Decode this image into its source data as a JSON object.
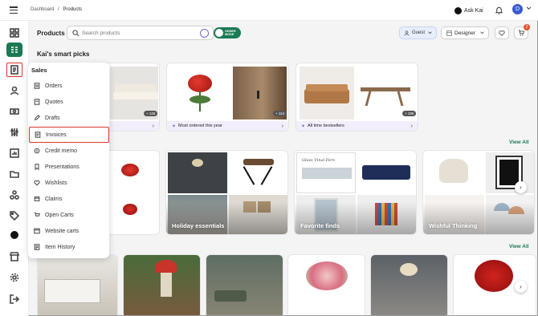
{
  "topbar": {
    "breadcrumb_root": "Dashboard",
    "breadcrumb_sep": "/",
    "breadcrumb_current": "Products",
    "ask_label": "Ask Kai",
    "avatar_initial": "D"
  },
  "header": {
    "title": "Products",
    "search_placeholder": "Search products",
    "order_mode_label": "ORDER MODE",
    "guest_label": "Guest",
    "designer_label": "Designer",
    "cart_count": "2"
  },
  "smart_picks": {
    "title": "Kai's smart picks",
    "cards": [
      {
        "badge": "+ 126",
        "caption": ""
      },
      {
        "badge": "+ 114",
        "caption": "Most ordered this year"
      },
      {
        "badge": "+ 195",
        "caption": "All time bestsellers"
      }
    ]
  },
  "collections": {
    "view_all": "View All",
    "cards": [
      {
        "label": ""
      },
      {
        "label": "Holiday essentials"
      },
      {
        "label": "Favorite finds",
        "art_text": "Glass Vinal Fers"
      },
      {
        "label": "Wishful Thinking"
      }
    ]
  },
  "products": {
    "view_all": "View All"
  },
  "sales_menu": {
    "title": "Sales",
    "items": [
      {
        "label": "Orders"
      },
      {
        "label": "Quotes"
      },
      {
        "label": "Drafts"
      },
      {
        "label": "Invoices"
      },
      {
        "label": "Credit memo"
      },
      {
        "label": "Presentations"
      },
      {
        "label": "Wishlists"
      },
      {
        "label": "Claims"
      },
      {
        "label": "Open Carts"
      },
      {
        "label": "Website carts"
      },
      {
        "label": "Item History"
      }
    ]
  },
  "colors": {
    "brand_green": "#1a7a53",
    "highlight_red": "#d9362b",
    "accent_purple": "#e9e3f8",
    "cart_badge": "#e8542f"
  },
  "icons": [
    "menu-icon",
    "bell-icon",
    "chevron-down-icon",
    "search-icon",
    "camera-icon",
    "heart-icon",
    "cart-icon",
    "user-icon",
    "chevron-right-icon"
  ]
}
